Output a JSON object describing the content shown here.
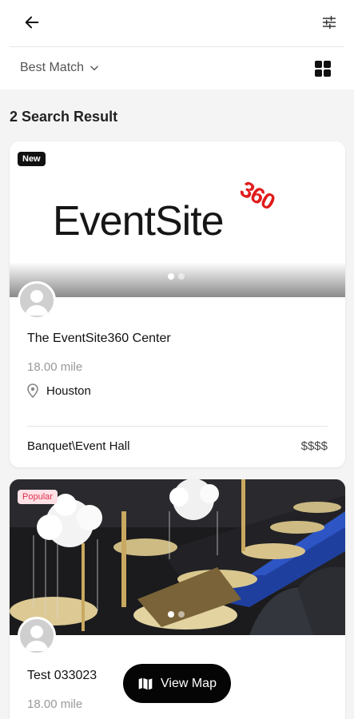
{
  "header": {
    "back_icon": "arrow-left-icon",
    "filter_icon": "sliders-icon",
    "sort_label": "Best Match",
    "grid_icon": "grid-icon"
  },
  "results_label": "2 Search Result",
  "cards": [
    {
      "badge": "New",
      "logo_text": "EventSite",
      "logo_badge": "360",
      "name": "The EventSite360 Center",
      "distance": "18.00 mile",
      "location": "Houston",
      "category": "Banquet\\Event Hall",
      "price": "$$$$"
    },
    {
      "badge": "Popular",
      "name": "Test 033023",
      "distance": "18.00 mile"
    }
  ],
  "view_map_label": "View Map",
  "colors": {
    "accent_red": "#e01b1b",
    "popular_bg": "#ffe1e6",
    "popular_text": "#e0304e",
    "button_bg": "#050505"
  }
}
